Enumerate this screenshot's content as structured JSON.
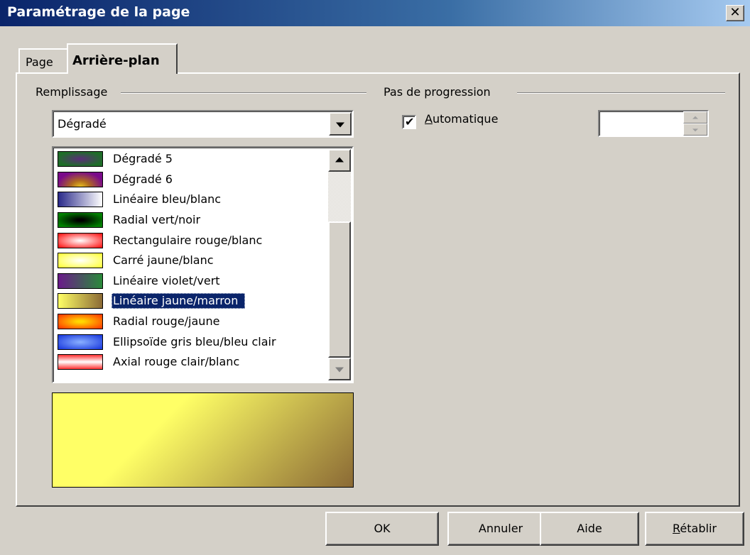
{
  "window": {
    "title": "Paramétrage de la page",
    "close_glyph": "✕"
  },
  "tabs": [
    {
      "label": "Page",
      "active": false
    },
    {
      "label": "Arrière-plan",
      "active": true
    }
  ],
  "fill": {
    "group_label": "Remplissage",
    "type_selected": "Dégradé",
    "gradients": [
      {
        "label": "Dégradé 5",
        "swatch": "radial-gradient(ellipse at center, #5a2d7a 0%, #1e6e28 75%)"
      },
      {
        "label": "Dégradé 6",
        "swatch": "radial-gradient(ellipse at 50% 100%, #e8c020 0%, #b06a20 30%, #7a0a8a 75%)"
      },
      {
        "label": "Linéaire bleu/blanc",
        "swatch": "linear-gradient(to right, #2a2a8a, #ffffff)"
      },
      {
        "label": "Radial vert/noir",
        "swatch": "radial-gradient(ellipse at center, #000000 10%, #008000 80%)"
      },
      {
        "label": "Rectangulaire rouge/blanc",
        "swatch": "radial-gradient(ellipse at center, #ffffff 0%, #ff2020 90%)"
      },
      {
        "label": "Carré jaune/blanc",
        "swatch": "radial-gradient(ellipse at center, #ffffff 0%, #ffff40 90%)"
      },
      {
        "label": "Linéaire violet/vert",
        "swatch": "linear-gradient(to right, #6a1a8a, #2a8a3a)"
      },
      {
        "label": "Linéaire jaune/marron",
        "swatch": "linear-gradient(to right, #ffff66, #8b6a35)",
        "selected": true
      },
      {
        "label": "Radial rouge/jaune",
        "swatch": "radial-gradient(ellipse at center, #ffd800 10%, #ff4000 90%)"
      },
      {
        "label": "Ellipsoïde gris bleu/bleu clair",
        "swatch": "radial-gradient(ellipse at center, #8ab0ff 0%, #2040e0 90%)"
      },
      {
        "label": "Axial rouge clair/blanc",
        "swatch": "linear-gradient(to bottom, #ff3030, #ffffff 50%, #ff3030)"
      }
    ],
    "preview_colors": [
      "#ffff66",
      "#8b6a35"
    ]
  },
  "step": {
    "group_label": "Pas de progression",
    "auto_label": "Automatique",
    "auto_accesskey": "A",
    "auto_checked": true,
    "check_glyph": "✔",
    "value": ""
  },
  "buttons": {
    "ok": "OK",
    "cancel": "Annuler",
    "help": "Aide",
    "reset": "Rétablir",
    "reset_accesskey": "R"
  }
}
